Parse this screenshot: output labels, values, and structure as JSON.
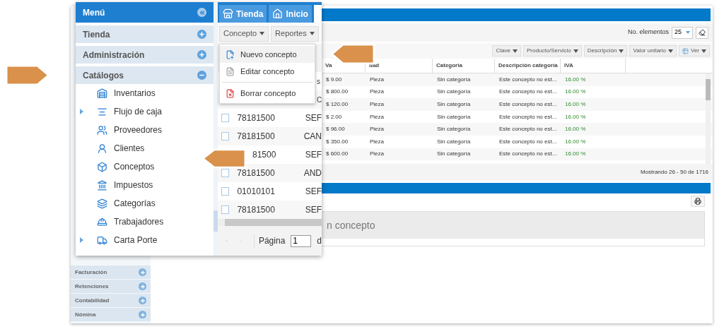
{
  "sidebar": {
    "items": [
      "Facturación",
      "Retenciones",
      "Contabilidad",
      "Nómina"
    ]
  },
  "main": {
    "page_size_label": "No. elementos",
    "page_size": "25",
    "column_buttons": [
      "Clave",
      "Producto/Servicio",
      "Descripción",
      "Valor unitario",
      "Ver"
    ],
    "columns": [
      "Va",
      "dad",
      "Categoria",
      "Descripción categoría",
      "IVA"
    ],
    "rows": [
      [
        "$ 9.00",
        "Pieza",
        "Sin categoría",
        "Este concepto no est...",
        "16.00 %"
      ],
      [
        "$ 800.00",
        "Pieza",
        "Sin categoría",
        "Este concepto no est...",
        "16.00 %"
      ],
      [
        "$ 120.00",
        "Pieza",
        "Sin categoría",
        "Este concepto no est...",
        "16.00 %"
      ],
      [
        "$ 2.00",
        "Pieza",
        "Sin categoría",
        "Este concepto no est...",
        "16.00 %"
      ],
      [
        "$ 96.00",
        "Pieza",
        "Sin categoría",
        "Este concepto no est...",
        "16.00 %"
      ],
      [
        "$ 350.00",
        "Pieza",
        "Sin categoría",
        "Este concepto no est...",
        "16.00 %"
      ],
      [
        "$ 600.00",
        "Pieza",
        "Sin categoría",
        "Este concepto no est...",
        "16.00 %"
      ]
    ],
    "status": "Mostrando 26 - 50 de 1716",
    "detail_title": "n concepto"
  },
  "menu": {
    "title": "Menú",
    "sections": [
      {
        "label": "Tienda",
        "expanded": false
      },
      {
        "label": "Administración",
        "expanded": false
      },
      {
        "label": "Catálogos",
        "expanded": true,
        "children": [
          {
            "label": "Inventarios",
            "expandable": false
          },
          {
            "label": "Flujo de caja",
            "expandable": true
          },
          {
            "label": "Proveedores",
            "expandable": false
          },
          {
            "label": "Clientes",
            "expandable": false
          },
          {
            "label": "Conceptos",
            "expandable": false
          },
          {
            "label": "Impuestos",
            "expandable": false
          },
          {
            "label": "Categorías",
            "expandable": false
          },
          {
            "label": "Trabajadores",
            "expandable": false
          },
          {
            "label": "Carta Porte",
            "expandable": true
          }
        ]
      }
    ]
  },
  "tabs": [
    {
      "label": "Tienda",
      "selected": false
    },
    {
      "label": "Inicio",
      "selected": false
    }
  ],
  "toolbar_buttons": [
    "Concepto",
    "Reportes"
  ],
  "dropdown": [
    {
      "label": "Nuevo concepto",
      "highlighted": true,
      "separator_before": false
    },
    {
      "label": "Editar concepto",
      "highlighted": false,
      "separator_before": false
    },
    {
      "label": "Borrar concepto",
      "highlighted": false,
      "separator_before": true
    }
  ],
  "list_rows": [
    {
      "kind": "text_only",
      "text": "s"
    },
    {
      "kind": "text_only",
      "text": "C"
    },
    {
      "kind": "full",
      "code": "78181500",
      "text": "SEF",
      "checked": false
    },
    {
      "kind": "full",
      "code": "78181500",
      "text": "CAN",
      "checked": false
    },
    {
      "kind": "covered",
      "code": "81500",
      "text": "SEF"
    },
    {
      "kind": "full",
      "code": "78181500",
      "text": "AND",
      "checked": false
    },
    {
      "kind": "full",
      "code": "01010101",
      "text": "SEF",
      "checked": false
    },
    {
      "kind": "full",
      "code": "78181500",
      "text": "SEF",
      "checked": false
    }
  ],
  "pagination": {
    "label": "Página",
    "page": "1",
    "suffix": "d"
  }
}
